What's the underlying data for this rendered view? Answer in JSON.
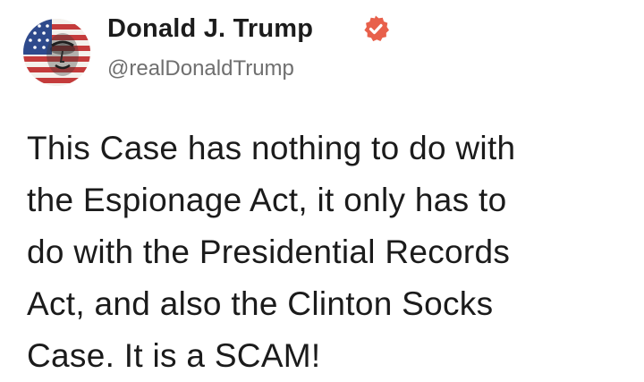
{
  "author": {
    "display_name": "Donald J. Trump",
    "handle": "@realDonaldTrump",
    "verified": true,
    "avatar_icon": "flag-portrait-avatar",
    "badge_icon": "verified-badge-icon",
    "badge_color": "#e8604b"
  },
  "post": {
    "lines": [
      "This Case has nothing to do with",
      "the Espionage Act, it only has to",
      "do with the Presidential Records",
      "Act, and also the Clinton Socks",
      "Case. It is a SCAM!"
    ]
  }
}
